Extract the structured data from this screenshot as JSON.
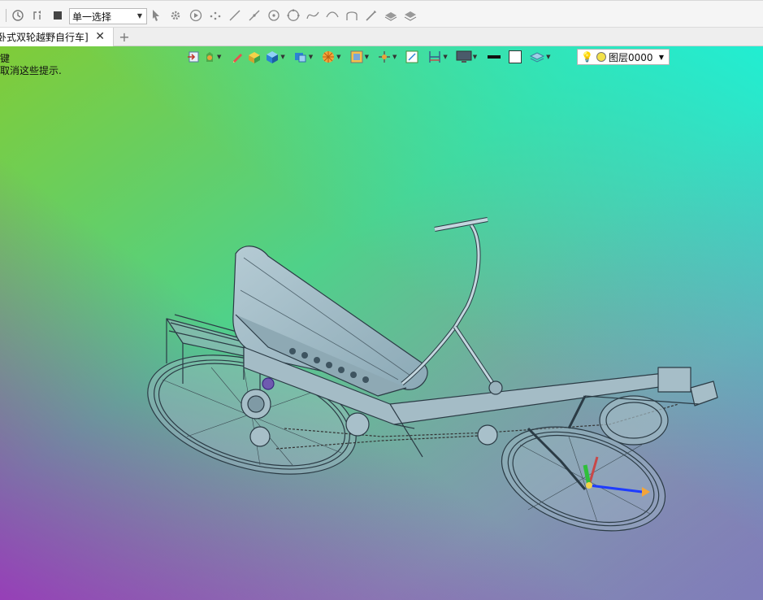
{
  "toolbar": {
    "selection_mode": "单一选择",
    "icons": [
      "history-icon",
      "undo-icon",
      "stop-icon",
      "select-cursor-icon",
      "gear-settings-icon",
      "play-icon",
      "points-icon",
      "line-icon",
      "line-segment-icon",
      "circle-point-icon",
      "circle-icon",
      "spline-icon",
      "arc-icon",
      "pen-icon",
      "stack-icon",
      "stack-down-icon"
    ]
  },
  "tabs": [
    {
      "label": "卧式双轮越野自行车]",
      "close": "✕"
    }
  ],
  "add_tab_label": "+",
  "hints": {
    "line1": "键",
    "line2": "取消这些提示."
  },
  "view_toolbar": {
    "layer_name": "图层0000",
    "icons": [
      "exit-icon",
      "render-mode-icon",
      "pencil-icon",
      "box-icon",
      "cube-icon",
      "view-cube-icon",
      "section-icon",
      "display-icon",
      "axes-icon",
      "fit-icon",
      "dimension-icon",
      "monitor-icon",
      "line-color-icon",
      "fill-color-icon",
      "layers-icon",
      "bulb-icon"
    ]
  },
  "colors": {
    "bg_top_left": "#80cc38",
    "bg_top_right": "#21eed2",
    "bg_bottom_left": "#a154b4",
    "bg_bottom_right": "#8ea2c0",
    "model_steel": "#9fb7c4",
    "model_outline": "#2b3b45"
  }
}
